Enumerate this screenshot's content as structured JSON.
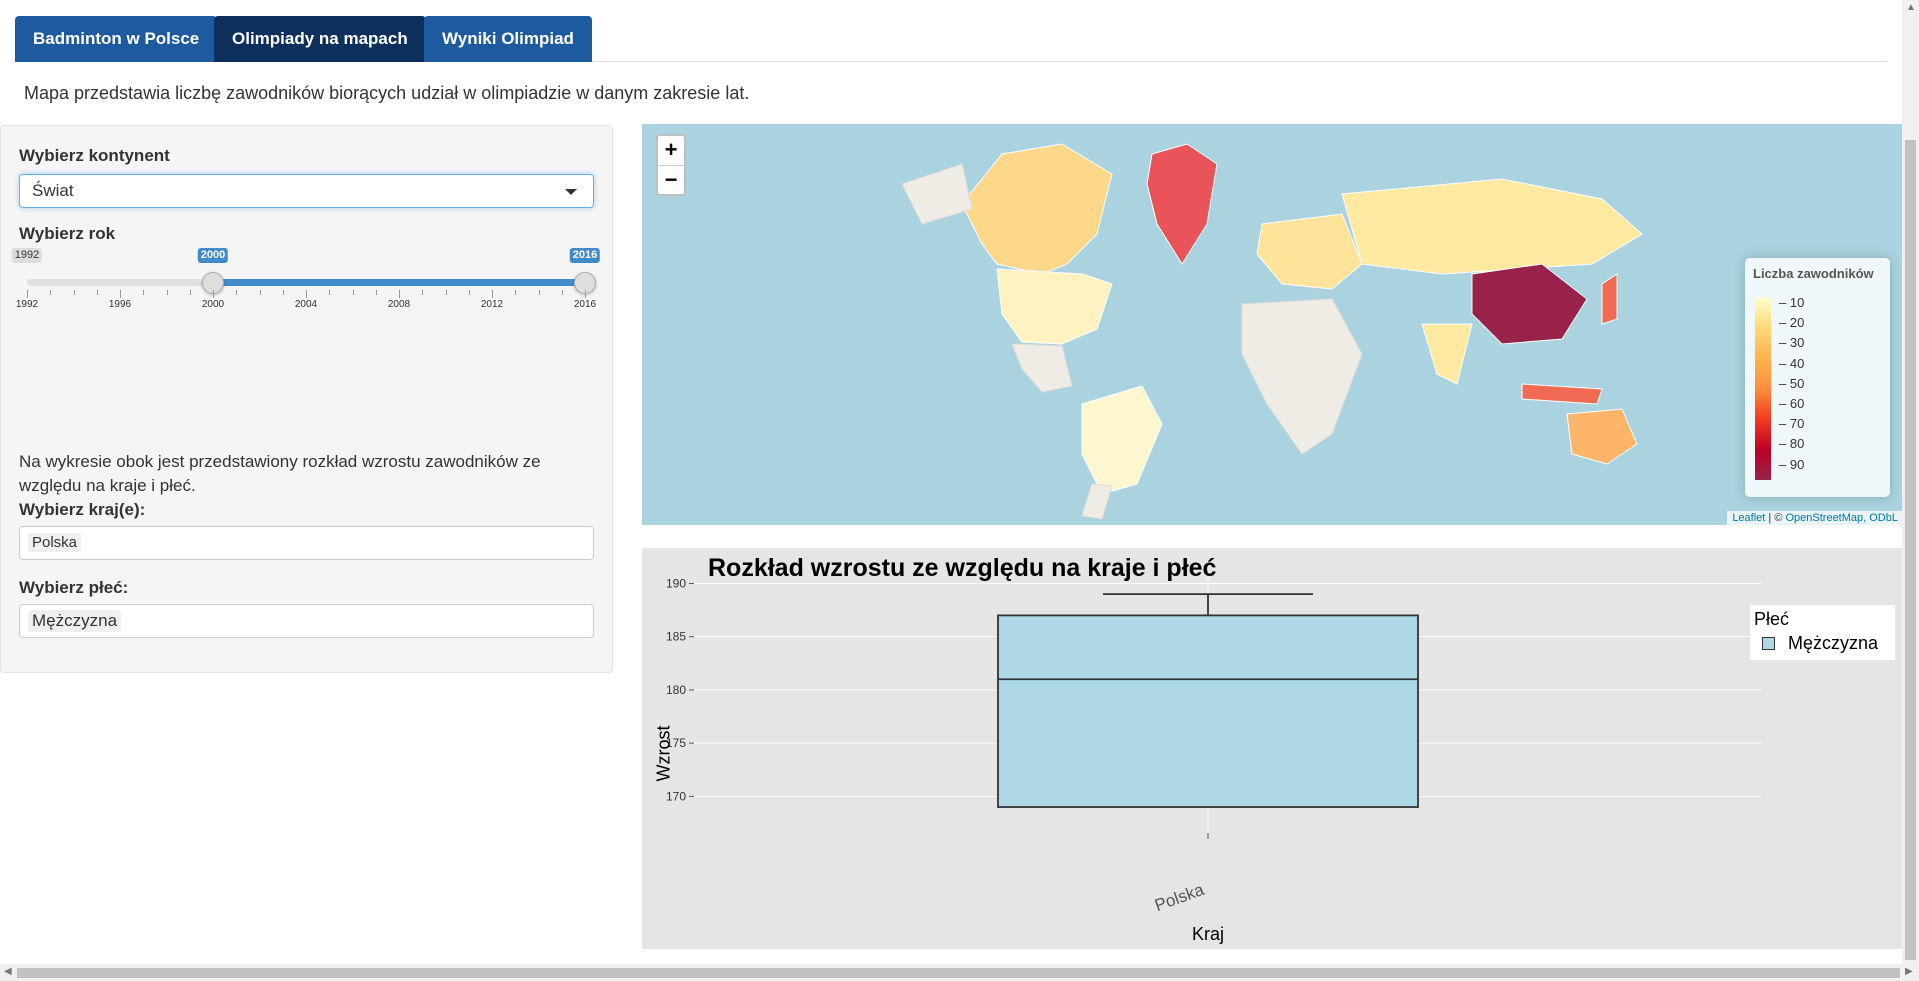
{
  "tabs": [
    {
      "label": "Badminton w Polsce",
      "active": false
    },
    {
      "label": "Olimpiady na mapach",
      "active": true
    },
    {
      "label": "Wyniki Olimpiad",
      "active": false
    }
  ],
  "intro": "Mapa przedstawia liczbę zawodników biorących udział w olimpiadzie w danym zakresie lat.",
  "sidebar": {
    "continent_label": "Wybierz kontynent",
    "continent_value": "Świat",
    "year_label": "Wybierz rok",
    "year_slider": {
      "min": 1992,
      "max": 2016,
      "from": 2000,
      "to": 2016,
      "min_label": "1992",
      "from_label": "2000",
      "to_label": "2016",
      "tick_labels": [
        "1992",
        "1996",
        "2000",
        "2004",
        "2008",
        "2012",
        "2016"
      ]
    },
    "description": "Na wykresie obok jest przedstawiony rozkład wzrostu zawodników ze względu na kraje i płeć.",
    "country_label": "Wybierz kraj(e):",
    "country_value": "Polska",
    "sex_label": "Wybierz płeć:",
    "sex_value": "Mężczyzna"
  },
  "map": {
    "zoom_in": "+",
    "zoom_out": "−",
    "legend_title": "Liczba zawodników",
    "legend_labels": [
      "10",
      "20",
      "30",
      "40",
      "50",
      "60",
      "70",
      "80",
      "90"
    ],
    "attribution_leaflet": "Leaflet",
    "attribution_sep": " | © ",
    "attribution_osm": "OpenStreetMap, ODbL",
    "colors": {
      "ocean": "#aad3df",
      "land": "#f2efe9",
      "high": "#98224a",
      "mid": "#f03b20",
      "low": "#ffffcc"
    }
  },
  "chart_data": {
    "type": "box",
    "title": "Rozkład wzrostu ze względu na kraje i płeć",
    "xlabel": "Kraj",
    "ylabel": "Wzrost",
    "categories": [
      "Polska"
    ],
    "ylim": [
      167.5,
      190.7
    ],
    "yticks": [
      170,
      175,
      180,
      185,
      190
    ],
    "series": [
      {
        "name": "Mężczyzna",
        "color": "#add8e6",
        "boxes": [
          {
            "category": "Polska",
            "min": 169,
            "q1": 169,
            "median": 181,
            "q3": 187,
            "max": 189
          }
        ]
      }
    ],
    "legend_title": "Płeć",
    "legend_position": "right"
  }
}
